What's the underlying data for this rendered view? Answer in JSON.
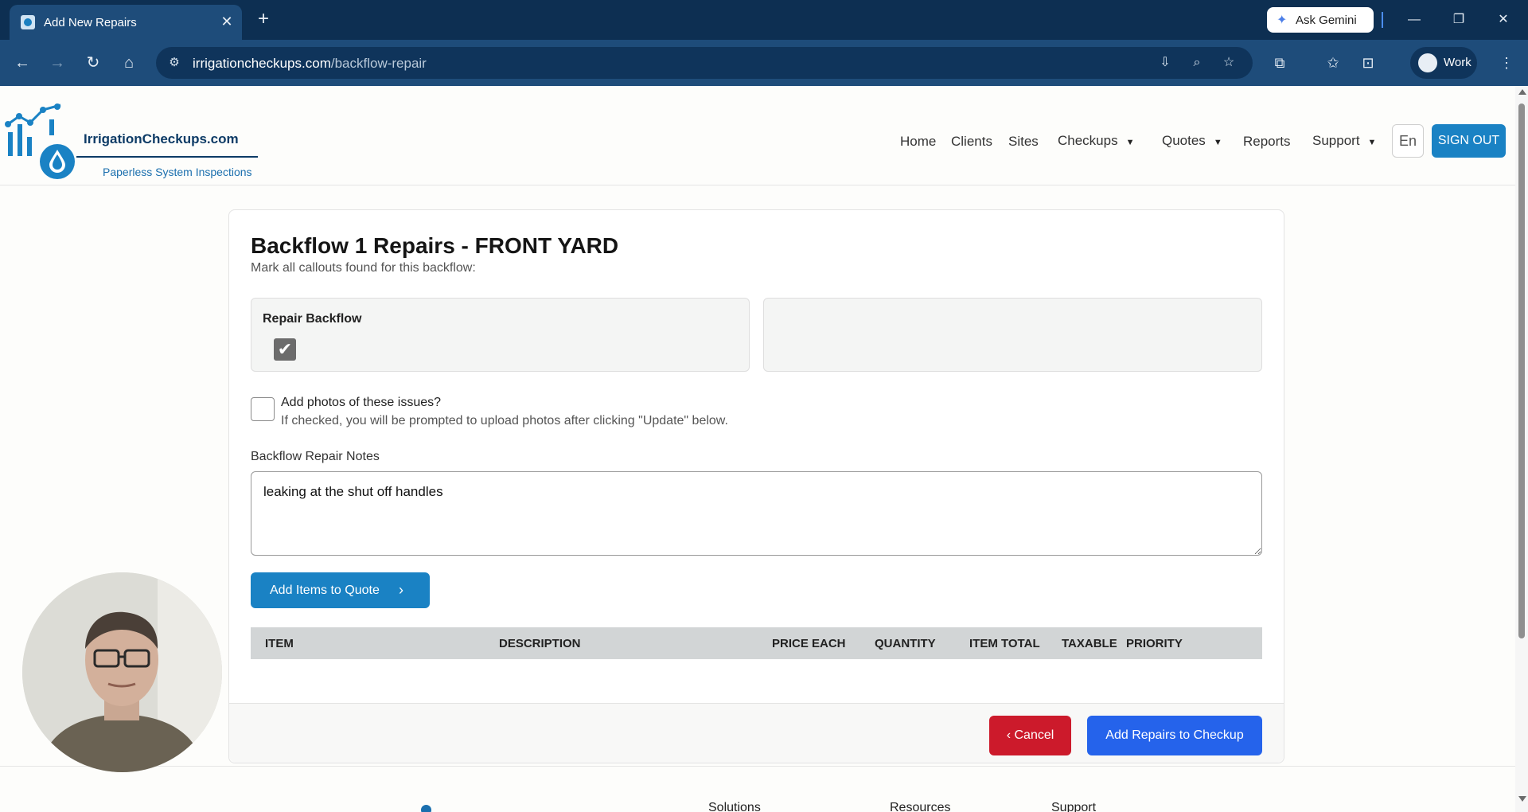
{
  "browser": {
    "tab_title": "Add New Repairs",
    "url_host": "irrigationcheckups.com",
    "url_path": "/backflow-repair",
    "gemini_label": "Ask Gemini",
    "profile_label": "Work"
  },
  "header": {
    "logo_name": "IrrigationCheckups.com",
    "logo_tagline": "Paperless System Inspections",
    "nav": {
      "home": "Home",
      "clients": "Clients",
      "sites": "Sites",
      "checkups": "Checkups",
      "quotes": "Quotes",
      "reports": "Reports",
      "support": "Support"
    },
    "language": "En",
    "sign_out": "SIGN OUT"
  },
  "form": {
    "title": "Backflow 1 Repairs - FRONT YARD",
    "subtitle": "Mark all callouts found for this backflow:",
    "callouts": [
      {
        "label": "Repair Backflow",
        "checked": true
      }
    ],
    "photos_label": "Add photos of these issues?",
    "photos_help": "If checked, you will be prompted to upload photos after clicking \"Update\" below.",
    "photos_checked": false,
    "notes_label": "Backflow Repair Notes",
    "notes_value": "leaking at the shut off handles",
    "add_items_label": "Add Items to Quote",
    "table_headers": {
      "item": "ITEM",
      "description": "DESCRIPTION",
      "price_each": "PRICE EACH",
      "quantity": "QUANTITY",
      "item_total": "ITEM TOTAL",
      "taxable": "TAXABLE",
      "priority": "PRIORITY"
    },
    "cancel_label": "Cancel",
    "submit_label": "Add Repairs to Checkup"
  },
  "footer": {
    "col1": "Solutions",
    "col2": "Resources",
    "col3": "Support"
  },
  "colors": {
    "primary": "#1a82c4",
    "danger": "#cc1a2b",
    "submit": "#2563eb",
    "browser_frame": "#0d2f52"
  }
}
